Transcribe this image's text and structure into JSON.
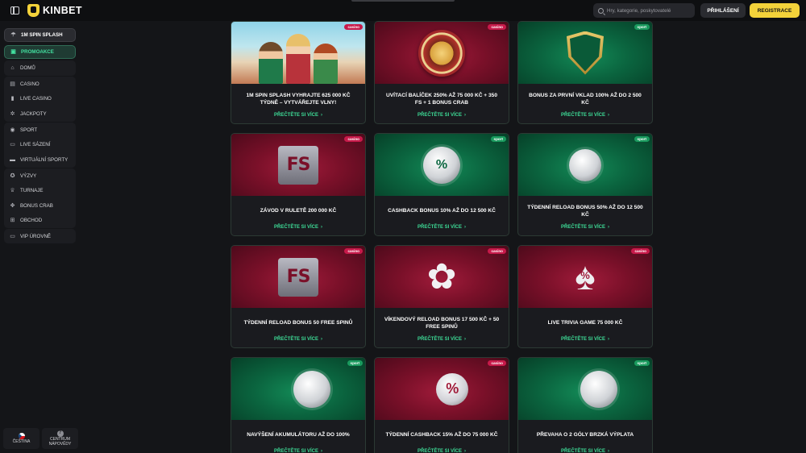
{
  "header": {
    "brand": "KINBET",
    "search_placeholder": "Hry, kategorie, poskytovatelé",
    "login_label": "PŘIHLÁŠENÍ",
    "register_label": "REGISTRACE"
  },
  "sidebar": {
    "spin_splash": "1M SPIN SPLASH",
    "promo": "PROMOAKCE",
    "home": "DOMŮ",
    "casino": "CASINO",
    "live_casino": "LIVE CASINO",
    "jackpots": "JACKPOTY",
    "sport": "SPORT",
    "live_bets": "LIVE SÁZENÍ",
    "virtual_sports": "VIRTUÁLNÍ SPORTY",
    "challenges": "VÝZVY",
    "tournaments": "TURNAJE",
    "bonus_crab": "BONUS CRAB",
    "shop": "OBCHOD",
    "vip": "VIP ÚROVNĚ",
    "language": "ČEŠTINA",
    "help_line1": "CENTRUM",
    "help_line2": "NÁPOVĚDY"
  },
  "promo_link_label": "PŘEČTĚTE SI VÍCE",
  "promos": [
    {
      "badge": "casino",
      "title": "1M SPIN SPLASH VYHRAJTE 625 000 KČ TÝDNĚ – VYTVÁŘEJTE VLNY!"
    },
    {
      "badge": "casino",
      "title": "UVÍTACÍ BALÍČEK 250% AŽ 75 000 KČ + 350 FS + 1 BONUS CRAB"
    },
    {
      "badge": "sport",
      "title": "BONUS ZA PRVNÍ VKLAD 100% AŽ DO 2 500 KČ"
    },
    {
      "badge": "casino",
      "title": "ZÁVOD V RULETĚ 200 000 KČ"
    },
    {
      "badge": "sport",
      "title": "CASHBACK BONUS 10% AŽ DO 12 500 KČ"
    },
    {
      "badge": "sport",
      "title": "TÝDENNÍ RELOAD BONUS 50% AŽ DO 12 500 KČ"
    },
    {
      "badge": "casino",
      "title": "TÝDENNÍ RELOAD BONUS 50 FREE SPINŮ"
    },
    {
      "badge": "casino",
      "title": "VÍKENDOVÝ RELOAD BONUS 17 500 KČ + 50 FREE SPINŮ"
    },
    {
      "badge": "casino",
      "title": "LIVE TRIVIA GAME 75 000 KČ"
    },
    {
      "badge": "sport",
      "title": "NAVÝŠENÍ AKUMULÁTORU AŽ DO 100%"
    },
    {
      "badge": "casino",
      "title": "TÝDENNÍ CASHBACK 15% AŽ DO 75 000 KČ"
    },
    {
      "badge": "sport",
      "title": "PŘEVAHA O 2 GÓLY BRZKÁ VÝPLATA"
    }
  ],
  "art": {
    "gift_text": "FS",
    "percent_text": "%"
  },
  "colors": {
    "accent_green": "#3ddc97",
    "register_yellow": "#f3d23a",
    "casino_badge": "#c71a4a",
    "sport_badge": "#1a9a5e"
  }
}
